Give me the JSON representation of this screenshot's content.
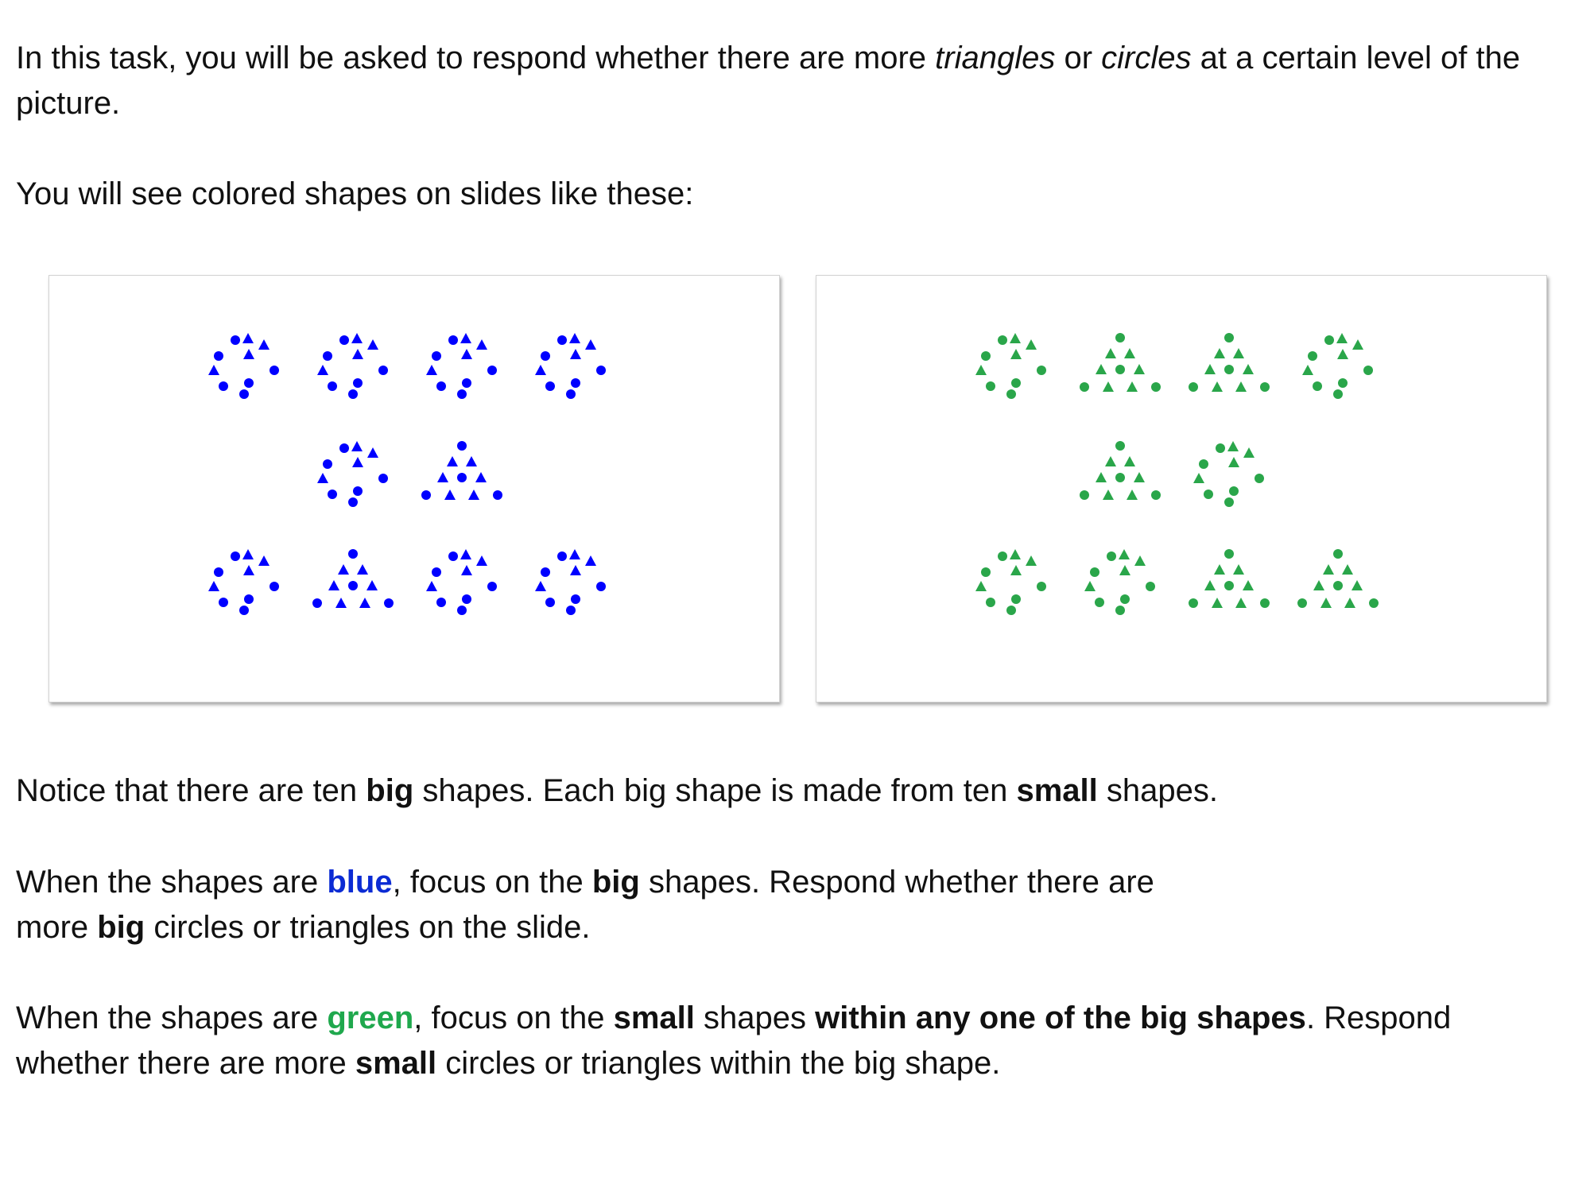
{
  "intro": {
    "p1_a": "In this task, you will be asked to respond whether there are more ",
    "p1_triangles": "triangles",
    "p1_or": " or ",
    "p1_circles": "circles",
    "p1_b": " at a certain level of the picture.",
    "p2": "You will see colored shapes on slides like these:"
  },
  "slides": [
    {
      "color": "#0000ff",
      "rows": [
        [
          "circle",
          "circle",
          "circle",
          "circle"
        ],
        [
          "circle",
          "triangle"
        ],
        [
          "circle",
          "triangle",
          "circle",
          "circle"
        ]
      ]
    },
    {
      "color": "#2aa64a",
      "rows": [
        [
          "circle",
          "triangle",
          "triangle",
          "circle"
        ],
        [
          "triangle",
          "circle"
        ],
        [
          "circle",
          "circle",
          "triangle",
          "triangle"
        ]
      ]
    }
  ],
  "notice": {
    "a": "Notice that there are ten ",
    "big": "big",
    "b": " shapes. Each big shape is made from ten ",
    "small": "small",
    "c": " shapes."
  },
  "blue_rule": {
    "a": "When the shapes are ",
    "color_word": "blue",
    "b": ", focus on the ",
    "big": "big",
    "c": " shapes. Respond whether there are",
    "d": "more ",
    "big2": "big",
    "e": " circles or triangles on the slide."
  },
  "green_rule": {
    "a": "When the shapes are ",
    "color_word": "green",
    "b": ", focus on the ",
    "small": "small",
    "c": " shapes ",
    "within": "within any one of the big shapes",
    "d": ". Respond",
    "e": "whether there are more ",
    "small2": "small",
    "f": " circles or triangles within the big shape."
  },
  "colors": {
    "blue_text": "#0b2bd4",
    "green_text": "#1fa84d"
  }
}
